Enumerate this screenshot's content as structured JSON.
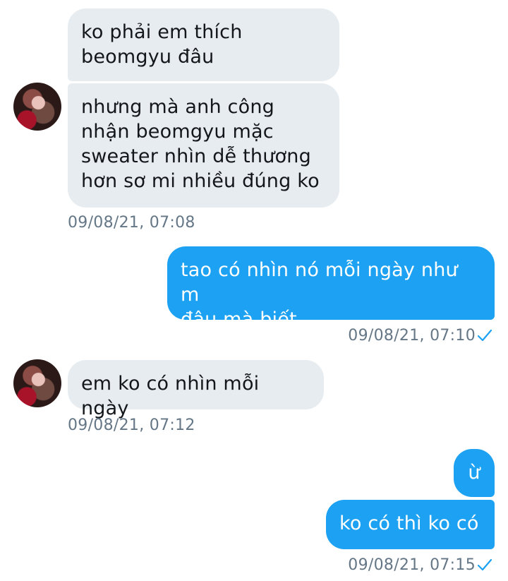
{
  "messages": [
    {
      "direction": "incoming",
      "text_lines": [
        "ko phải em thích",
        "beomgyu đâu"
      ]
    },
    {
      "direction": "incoming",
      "text_lines": [
        "nhưng mà anh công",
        "nhận beomgyu mặc",
        "sweater nhìn dễ thương",
        "hơn sơ mi nhiều đúng ko"
      ],
      "timestamp": "09/08/21, 07:08"
    },
    {
      "direction": "outgoing",
      "text_lines": [
        "tao có nhìn nó mỗi ngày như m",
        "đâu mà biết"
      ],
      "timestamp": "09/08/21, 07:10",
      "status_icon": "check-icon"
    },
    {
      "direction": "incoming",
      "text_lines": [
        "em ko có nhìn mỗi ngày"
      ],
      "timestamp": "09/08/21, 07:12"
    },
    {
      "direction": "outgoing",
      "text_lines": [
        "ừ"
      ]
    },
    {
      "direction": "outgoing",
      "text_lines": [
        "ko có thì ko có"
      ],
      "timestamp": "09/08/21, 07:15",
      "status_icon": "check-icon"
    }
  ],
  "colors": {
    "incoming_bubble": "#e6ecf0",
    "outgoing_bubble": "#1da1f2",
    "timestamp_text": "#657786",
    "check": "#1da1f2"
  }
}
